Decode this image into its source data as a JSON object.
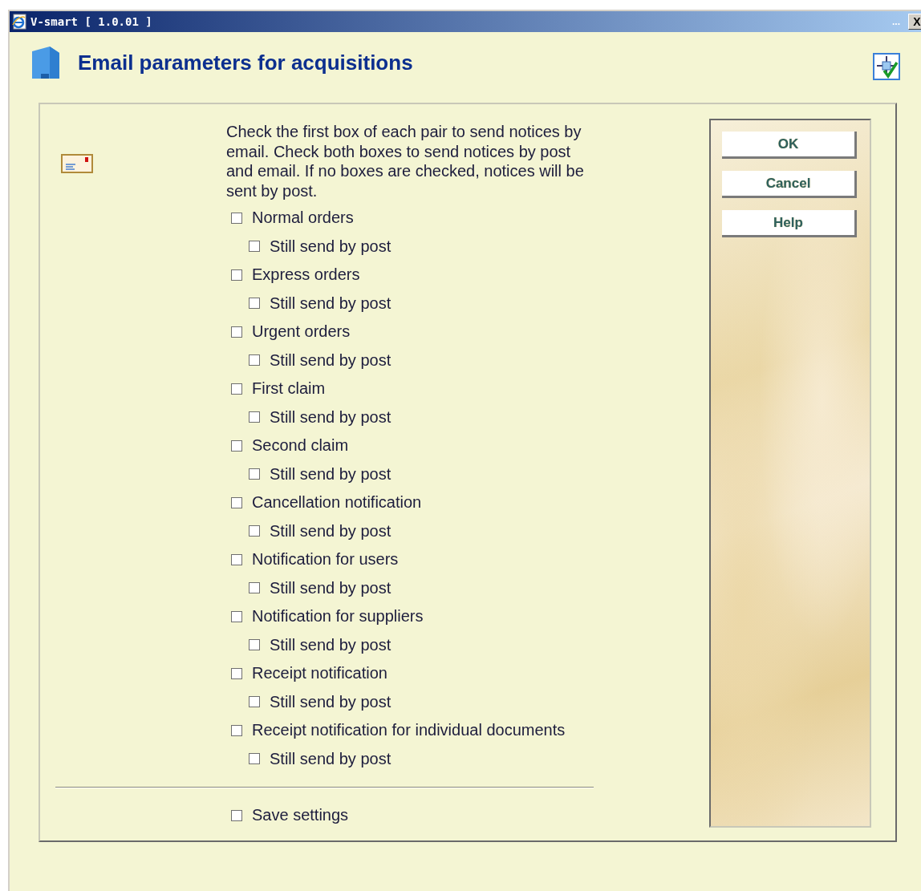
{
  "window": {
    "title": "V-smart [ 1.0.01 ]",
    "more": "...",
    "close": "X"
  },
  "header": {
    "title": "Email parameters for acquisitions"
  },
  "intro": "Check the first box of each pair to send notices by email. Check both boxes to send notices by post and email. If no boxes are checked, notices will be sent by post.",
  "options": [
    {
      "label": "Normal orders",
      "checked": false,
      "children": [
        {
          "label": "Still send by post",
          "checked": false
        }
      ]
    },
    {
      "label": "Express orders",
      "checked": false,
      "children": [
        {
          "label": "Still send by post",
          "checked": false
        }
      ]
    },
    {
      "label": "Urgent orders",
      "checked": false,
      "children": [
        {
          "label": "Still send by post",
          "checked": false
        }
      ]
    },
    {
      "label": "First claim",
      "checked": false,
      "children": [
        {
          "label": "Still send by post",
          "checked": false
        }
      ]
    },
    {
      "label": "Second claim",
      "checked": false,
      "children": [
        {
          "label": "Still send by post",
          "checked": false
        }
      ]
    },
    {
      "label": "Cancellation notification",
      "checked": false,
      "children": [
        {
          "label": "Still send by post",
          "checked": false
        }
      ]
    },
    {
      "label": "Notification for users",
      "checked": false,
      "children": [
        {
          "label": "Still send by post",
          "checked": false
        }
      ]
    },
    {
      "label": "Notification for suppliers",
      "checked": false,
      "children": [
        {
          "label": "Still send by post",
          "checked": false
        }
      ]
    },
    {
      "label": "Receipt notification",
      "checked": false,
      "children": [
        {
          "label": "Still send by post",
          "checked": false
        }
      ]
    },
    {
      "label": "Receipt notification for individual documents",
      "checked": false,
      "children": [
        {
          "label": "Still send by post",
          "checked": false
        }
      ]
    }
  ],
  "save_settings": {
    "label": "Save settings",
    "checked": false
  },
  "buttons": [
    "OK",
    "Cancel",
    "Help"
  ]
}
